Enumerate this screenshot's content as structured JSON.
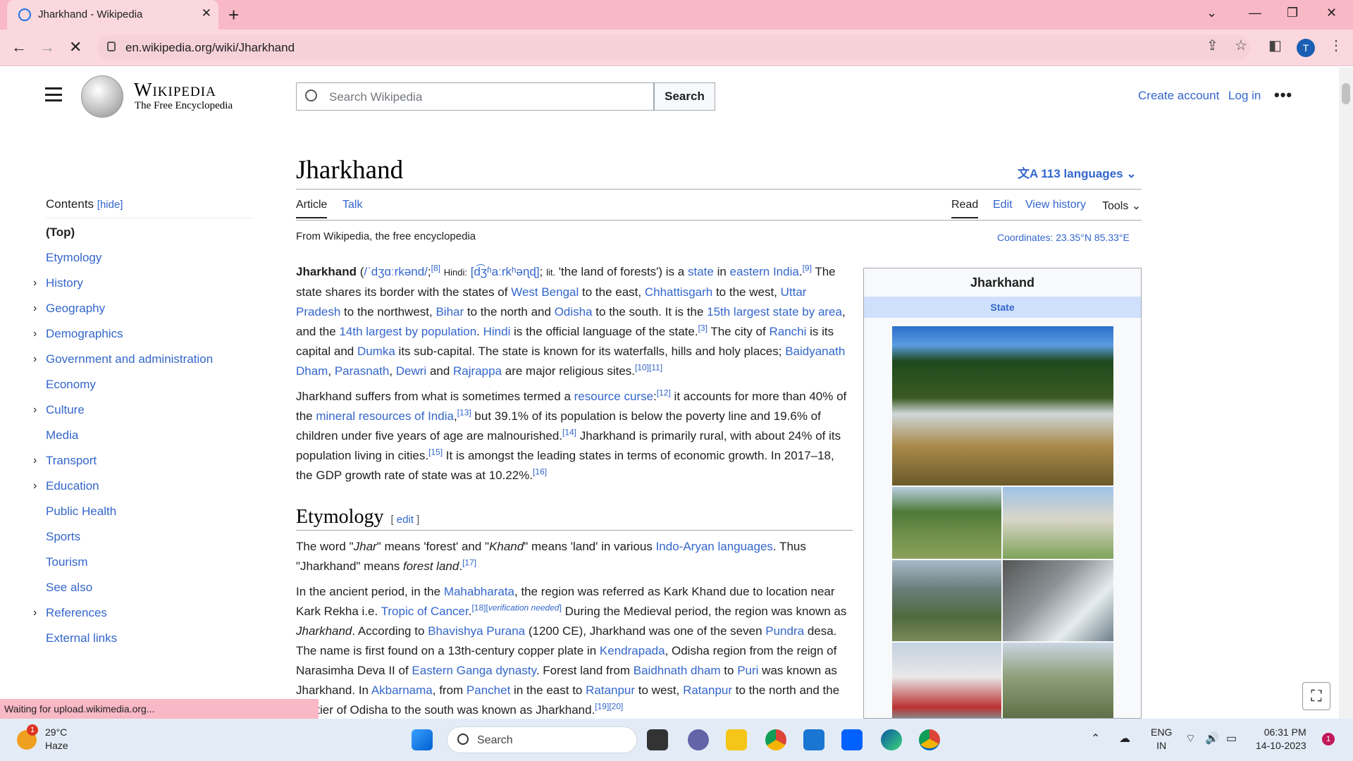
{
  "browser": {
    "tab_title": "Jharkhand - Wikipedia",
    "url": "en.wikipedia.org/wiki/Jharkhand",
    "profile_initial": "T",
    "status": "Waiting for upload.wikimedia.org..."
  },
  "header": {
    "wordmark": "Wikipedia",
    "tagline": "The Free Encyclopedia",
    "search_placeholder": "Search Wikipedia",
    "search_button": "Search",
    "create_account": "Create account",
    "log_in": "Log in"
  },
  "toc": {
    "title": "Contents",
    "hide": "[hide]",
    "items": [
      {
        "label": "(Top)",
        "expandable": false
      },
      {
        "label": "Etymology",
        "expandable": false
      },
      {
        "label": "History",
        "expandable": true
      },
      {
        "label": "Geography",
        "expandable": true
      },
      {
        "label": "Demographics",
        "expandable": true
      },
      {
        "label": "Government and administration",
        "expandable": true
      },
      {
        "label": "Economy",
        "expandable": false
      },
      {
        "label": "Culture",
        "expandable": true
      },
      {
        "label": "Media",
        "expandable": false
      },
      {
        "label": "Transport",
        "expandable": true
      },
      {
        "label": "Education",
        "expandable": true
      },
      {
        "label": "Public Health",
        "expandable": false
      },
      {
        "label": "Sports",
        "expandable": false
      },
      {
        "label": "Tourism",
        "expandable": false
      },
      {
        "label": "See also",
        "expandable": false
      },
      {
        "label": "References",
        "expandable": true
      },
      {
        "label": "External links",
        "expandable": false
      }
    ]
  },
  "article": {
    "title": "Jharkhand",
    "languages": "113 languages",
    "tabs": {
      "article": "Article",
      "talk": "Talk",
      "read": "Read",
      "edit": "Edit",
      "history": "View history",
      "tools": "Tools"
    },
    "from": "From Wikipedia, the free encyclopedia",
    "coordinates": "Coordinates: 23.35°N 85.33°E",
    "section_etymology": "Etymology",
    "section_edit": "edit"
  },
  "infobox": {
    "name": "Jharkhand",
    "type": "State"
  },
  "taskbar": {
    "temp": "29°C",
    "weather": "Haze",
    "search": "Search",
    "lang1": "ENG",
    "lang2": "IN",
    "time": "06:31 PM",
    "date": "14-10-2023",
    "weather_badge": "1",
    "notif_badge": "1"
  }
}
